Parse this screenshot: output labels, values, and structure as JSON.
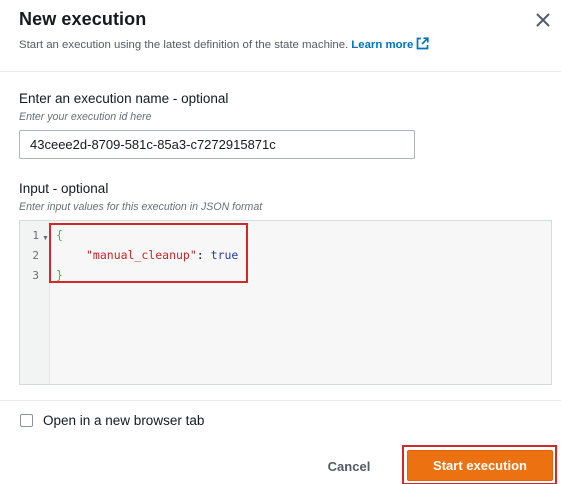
{
  "dialog": {
    "title": "New execution",
    "subtitle": "Start an execution using the latest definition of the state machine.",
    "learn_more": "Learn more",
    "close_icon": "close-icon",
    "external_icon": "external-link-icon"
  },
  "execution_name": {
    "label": "Enter an execution name - optional",
    "hint": "Enter your execution id here",
    "value": "43ceee2d-8709-581c-85a3-c7272915871c"
  },
  "input": {
    "label": "Input - optional",
    "hint": "Enter input values for this execution in JSON format",
    "line_numbers": [
      "1",
      "2",
      "3"
    ],
    "lines": {
      "open_brace": "{",
      "key": "\"manual_cleanup\"",
      "colon": ": ",
      "value": "true",
      "close_brace": "}"
    }
  },
  "options": {
    "open_new_tab_label": "Open in a new browser tab",
    "open_new_tab_checked": false
  },
  "footer": {
    "cancel_label": "Cancel",
    "start_label": "Start execution"
  },
  "colors": {
    "accent": "#ec7211",
    "link": "#0073bb",
    "highlight": "#d1292a"
  }
}
